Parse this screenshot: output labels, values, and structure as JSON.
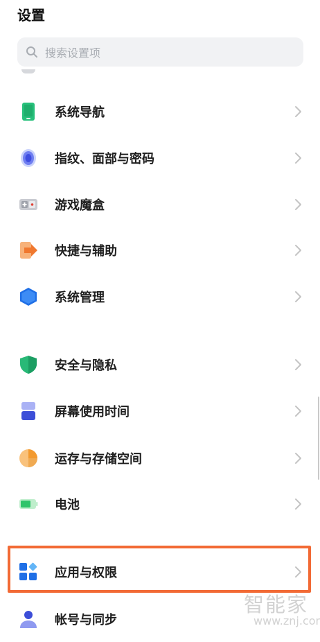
{
  "header": {
    "title": "设置"
  },
  "search": {
    "placeholder": "搜索设置项"
  },
  "menu": [
    {
      "label": "系统导航",
      "icon": "phone-navigation-icon"
    },
    {
      "label": "指纹、面部与密码",
      "icon": "fingerprint-icon"
    },
    {
      "label": "游戏魔盒",
      "icon": "game-box-icon"
    },
    {
      "label": "快捷与辅助",
      "icon": "shortcut-arrow-icon"
    },
    {
      "label": "系统管理",
      "icon": "hexagon-system-icon"
    },
    {
      "label": "安全与隐私",
      "icon": "shield-icon"
    },
    {
      "label": "屏幕使用时间",
      "icon": "hourglass-icon"
    },
    {
      "label": "运存与存储空间",
      "icon": "storage-pie-icon"
    },
    {
      "label": "电池",
      "icon": "battery-icon"
    },
    {
      "label": "应用与权限",
      "icon": "apps-grid-icon"
    },
    {
      "label": "帐号与同步",
      "icon": "account-icon"
    }
  ],
  "watermark": {
    "text": "智能家",
    "url": "www.znj.com"
  },
  "colors": {
    "highlight": "#f26a35",
    "search_bg": "#f1f2f4",
    "chevron": "#c4c4c4"
  }
}
